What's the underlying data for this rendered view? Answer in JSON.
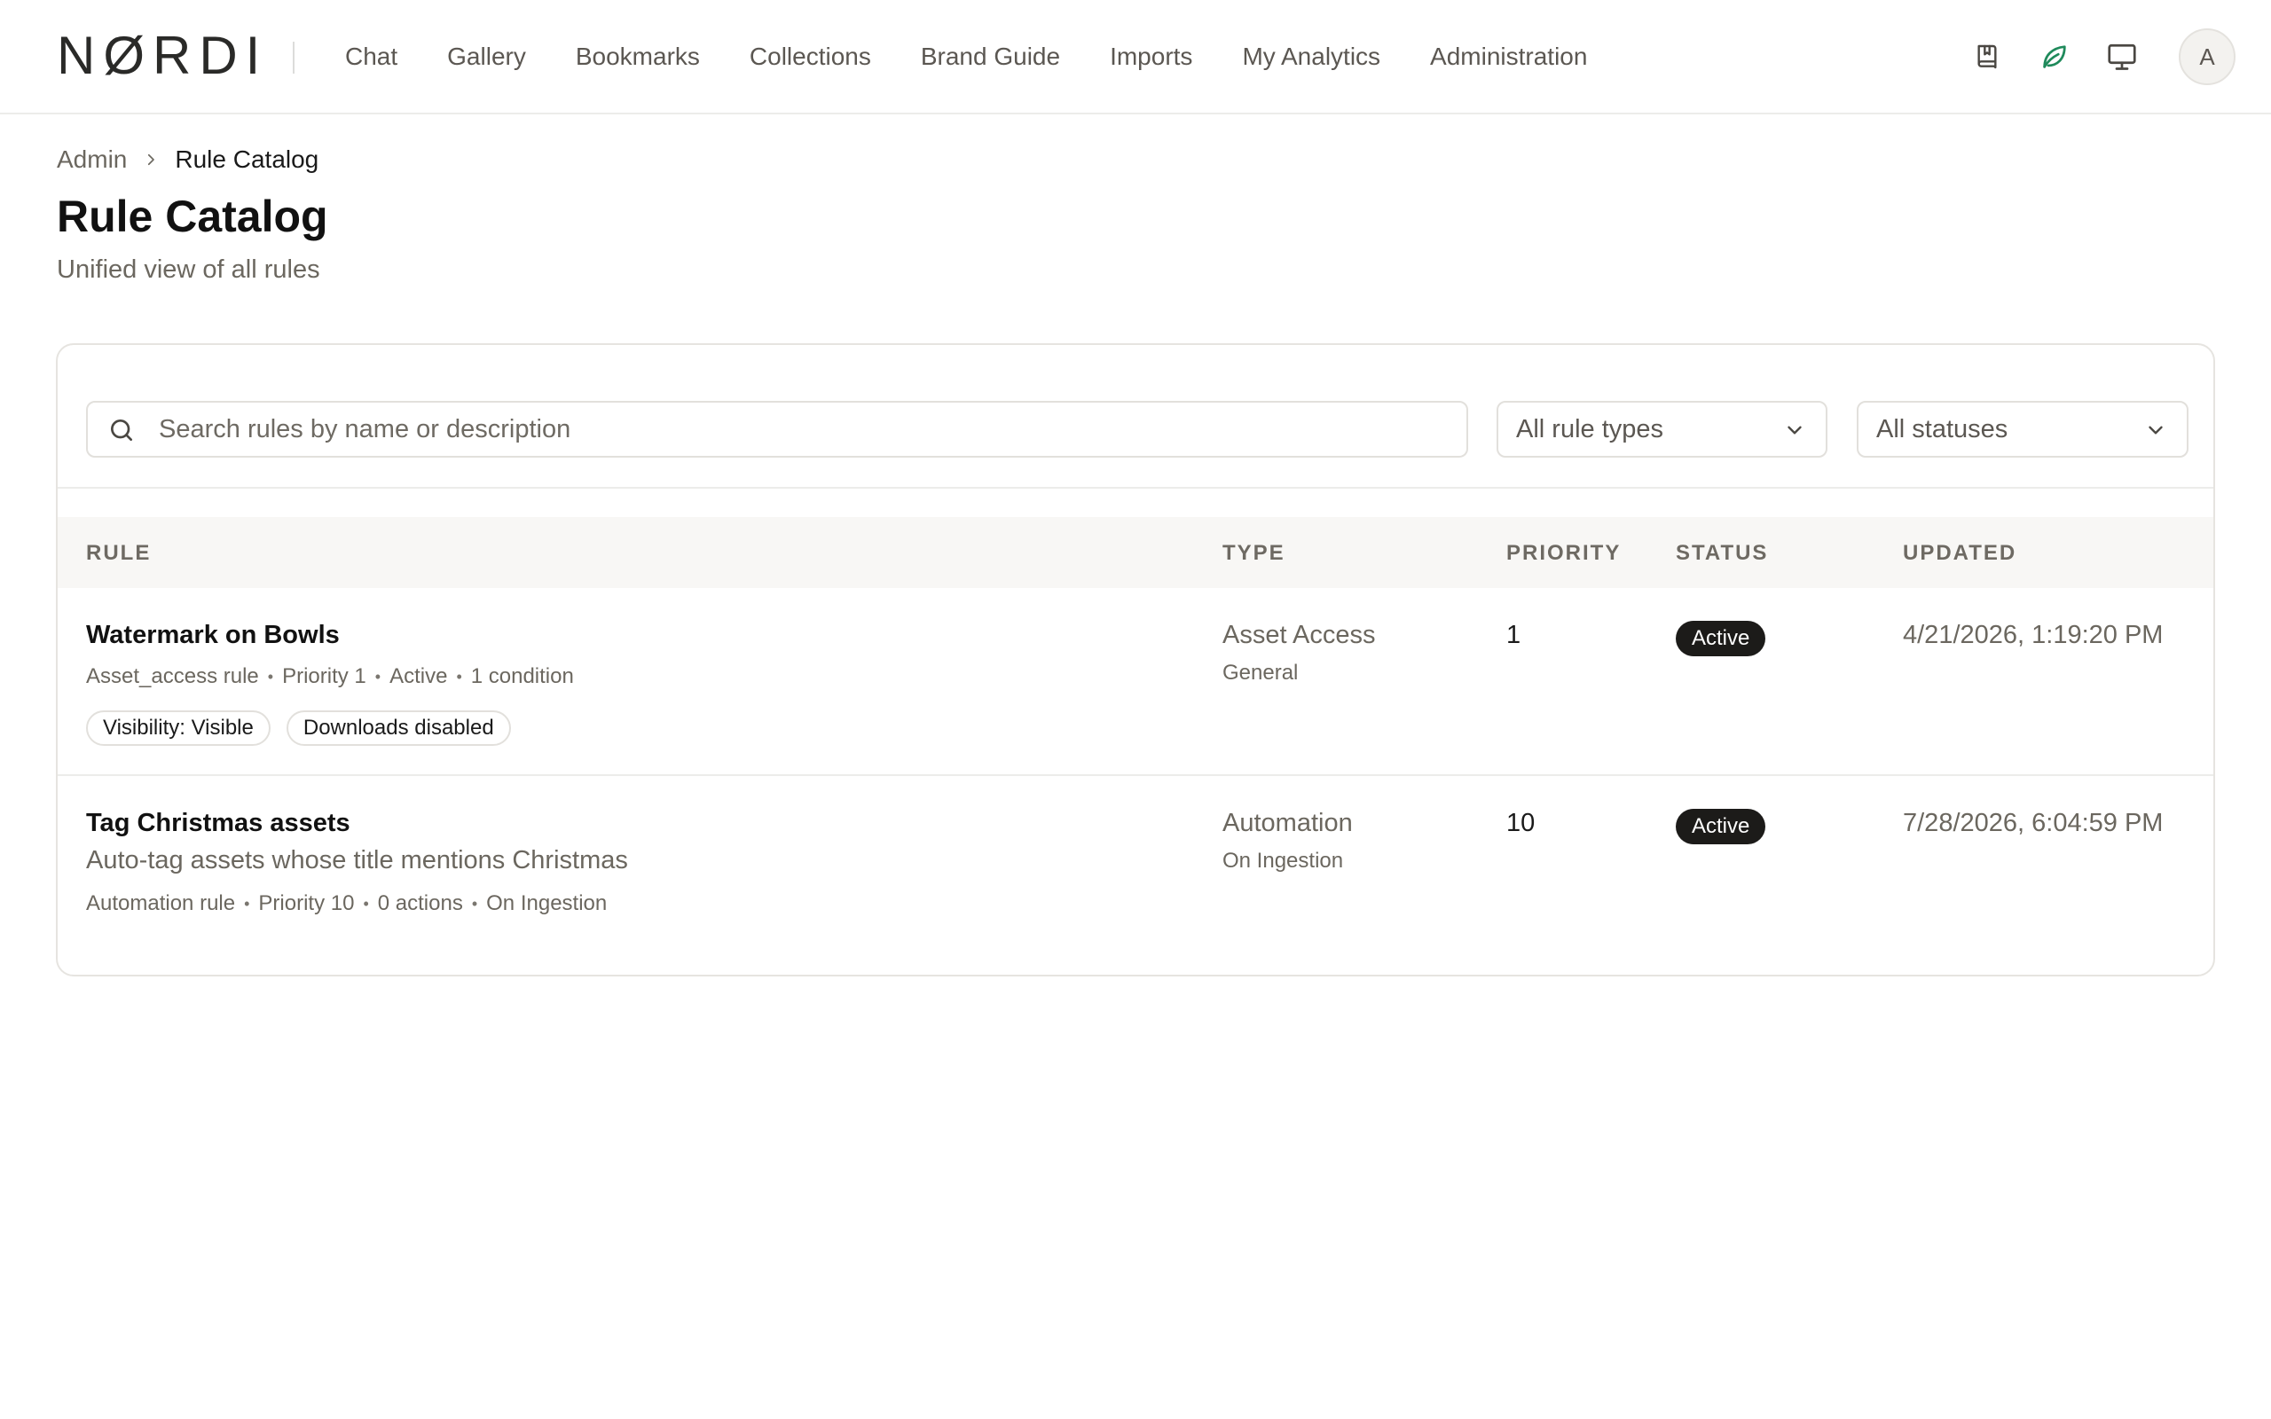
{
  "brand": {
    "logo_text": "NØRDI",
    "accent": "#1f8a5b"
  },
  "nav": {
    "items": [
      "Chat",
      "Gallery",
      "Bookmarks",
      "Collections",
      "Brand Guide",
      "Imports",
      "My Analytics",
      "Administration"
    ],
    "right_icons": [
      "bookmark-book-icon",
      "leaf-icon",
      "monitor-icon"
    ],
    "avatar_initial": "A"
  },
  "breadcrumb": {
    "parent": "Admin",
    "current": "Rule Catalog"
  },
  "page": {
    "title": "Rule Catalog",
    "subtitle": "Unified view of all rules"
  },
  "filters": {
    "search_placeholder": "Search rules by name or description",
    "rule_type": "All rule types",
    "status": "All statuses"
  },
  "table": {
    "headers": {
      "rule": "RULE",
      "type": "TYPE",
      "priority": "PRIORITY",
      "status": "STATUS",
      "updated": "UPDATED"
    },
    "rows": [
      {
        "name": "Watermark on Bowls",
        "meta": [
          "Asset_access rule",
          "Priority 1",
          "Active",
          "1 condition"
        ],
        "chips": [
          "Visibility: Visible",
          "Downloads disabled"
        ],
        "type": "Asset Access",
        "subtype": "General",
        "priority": "1",
        "status": "Active",
        "updated": "4/21/2026, 1:19:20 PM"
      },
      {
        "name": "Tag Christmas assets",
        "description": "Auto-tag assets whose title mentions Christmas",
        "meta": [
          "Automation rule",
          "Priority 10",
          "0 actions",
          "On Ingestion"
        ],
        "type": "Automation",
        "subtype": "On Ingestion",
        "priority": "10",
        "status": "Active",
        "updated": "7/28/2026, 6:04:59 PM"
      }
    ]
  }
}
